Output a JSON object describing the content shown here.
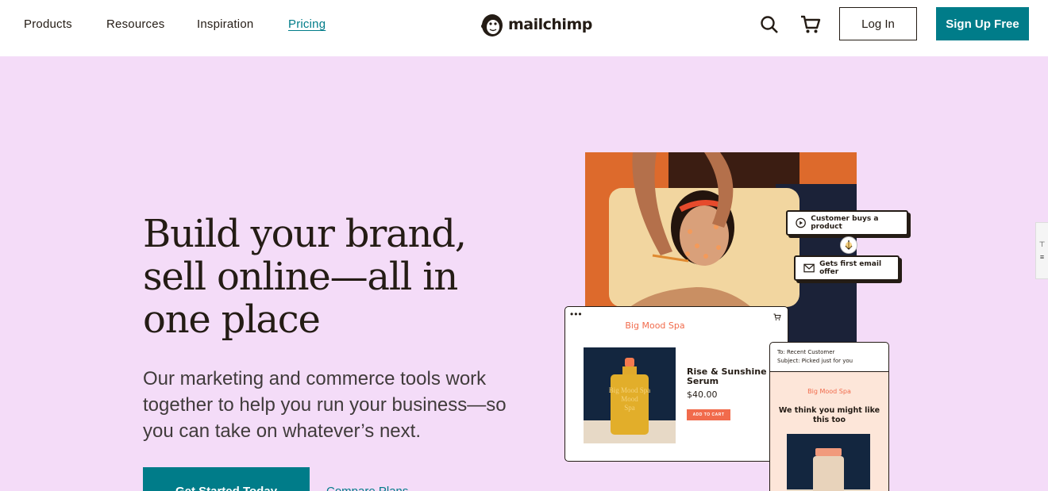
{
  "nav": {
    "links": [
      "Products",
      "Resources",
      "Inspiration",
      "Pricing"
    ],
    "logo_text": "mailchimp",
    "login_label": "Log In",
    "signup_label": "Sign Up Free"
  },
  "hero": {
    "title": "Build your brand, sell online—all in one place",
    "subtitle": "Our marketing and commerce tools work together to help you run your business—so you can take on whatever’s next.",
    "cta_label": "Get Started Today",
    "compare_label": "Compare Plans"
  },
  "flow": {
    "step1": "Customer buys a product",
    "step2": "Gets first email offer"
  },
  "store": {
    "name": "Big Mood Spa",
    "product_name": "Rise & Sunshine Serum",
    "price": "$40.00",
    "add_to_cart": "ADD TO CART",
    "bottle_label": "Big Mood Spa"
  },
  "email": {
    "to_line": "To: Recent Customer",
    "subject_line": "Subject: Picked just for you",
    "store_name": "Big Mood Spa",
    "headline": "We think you might like this too"
  },
  "colors": {
    "brand_teal": "#007c89",
    "hero_bg": "#f4dcf8",
    "accent_coral": "#f16b4c",
    "ink": "#241c15"
  },
  "icons": [
    "search-icon",
    "cart-icon",
    "play-icon",
    "envelope-icon",
    "arrow-down-icon",
    "mailchimp-logo"
  ]
}
